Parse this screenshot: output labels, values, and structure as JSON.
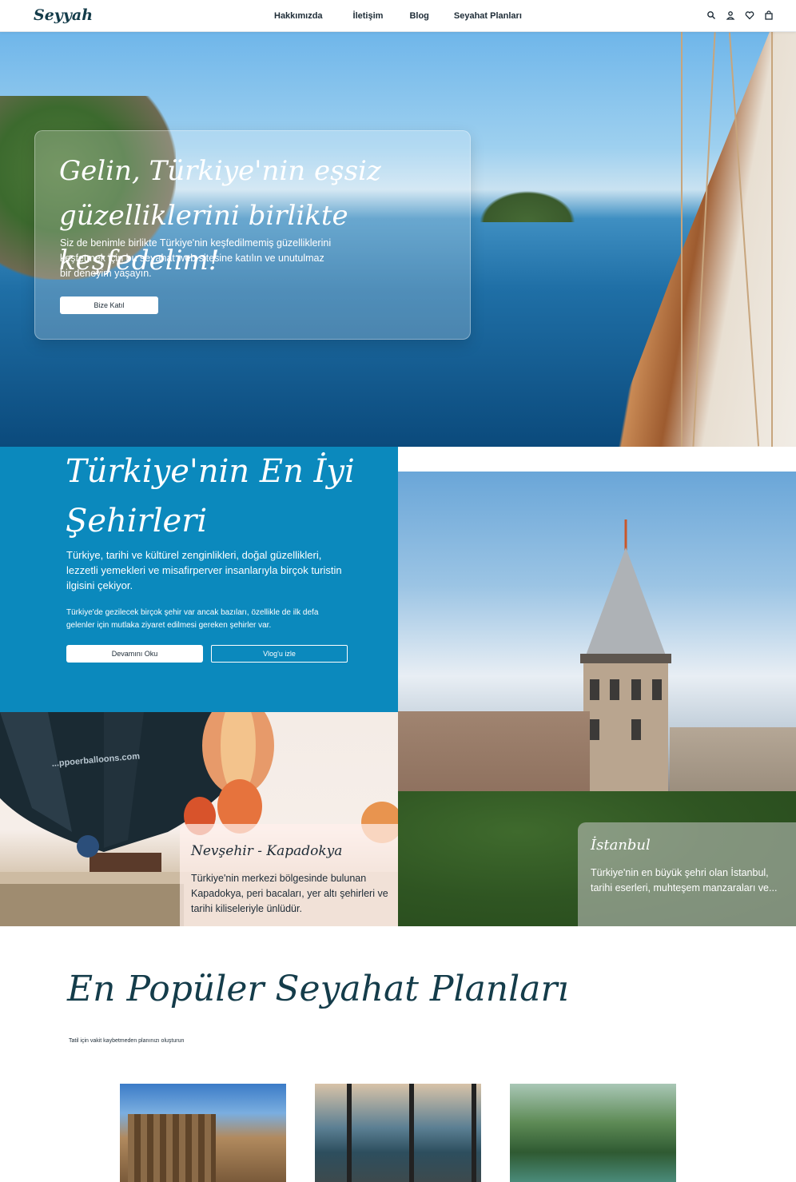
{
  "nav": {
    "logo": "Seyyah",
    "links": [
      "Hakkımızda",
      "İletişim",
      "Blog",
      "Seyahat Planları"
    ],
    "icons": [
      "search-icon",
      "user-icon",
      "heart-icon",
      "bag-icon"
    ]
  },
  "hero": {
    "title": "Gelin, Türkiye'nin eşsiz güzelliklerini birlikte keşfedelim!",
    "text": "Siz de benimle birlikte Türkiye'nin keşfedilmemiş güzelliklerini keşfetmek için bu seyahat web sitesine katılın ve unutulmaz bir deneyim yaşayın.",
    "button": "Bize Katıl"
  },
  "cities": {
    "title": "Türkiye'nin En İyi Şehirleri",
    "p1": "Türkiye, tarihi ve kültürel zenginlikleri, doğal güzellikleri, lezzetli yemekleri ve misafirperver insanlarıyla birçok turistin ilgisini çekiyor.",
    "p2": "Türkiye'de gezilecek birçok şehir var ancak bazıları, özellikle de ilk defa gelenler için mutlaka ziyaret edilmesi gereken şehirler var.",
    "btn_read": "Devamını Oku",
    "btn_vlog": "Vlog'u izle",
    "kapadokya": {
      "title": "Nevşehir - Kapadokya",
      "text": "Türkiye'nin merkezi bölgesinde bulunan Kapadokya, peri bacaları, yer altı şehirleri ve tarihi kiliseleriyle ünlüdür.",
      "balloon_text": "...ppoerballoons.com"
    },
    "istanbul": {
      "title": "İstanbul",
      "text": "Türkiye'nin en büyük şehri olan İstanbul, tarihi eserleri, muhteşem manzaraları ve..."
    }
  },
  "popular": {
    "title": "En Popüler Seyahat Planları",
    "subtitle": "Tatil için vakit kaybetmeden planınızı oluşturun"
  },
  "colors": {
    "accent_blue": "#0b89bd",
    "dark_teal": "#143c4a"
  }
}
